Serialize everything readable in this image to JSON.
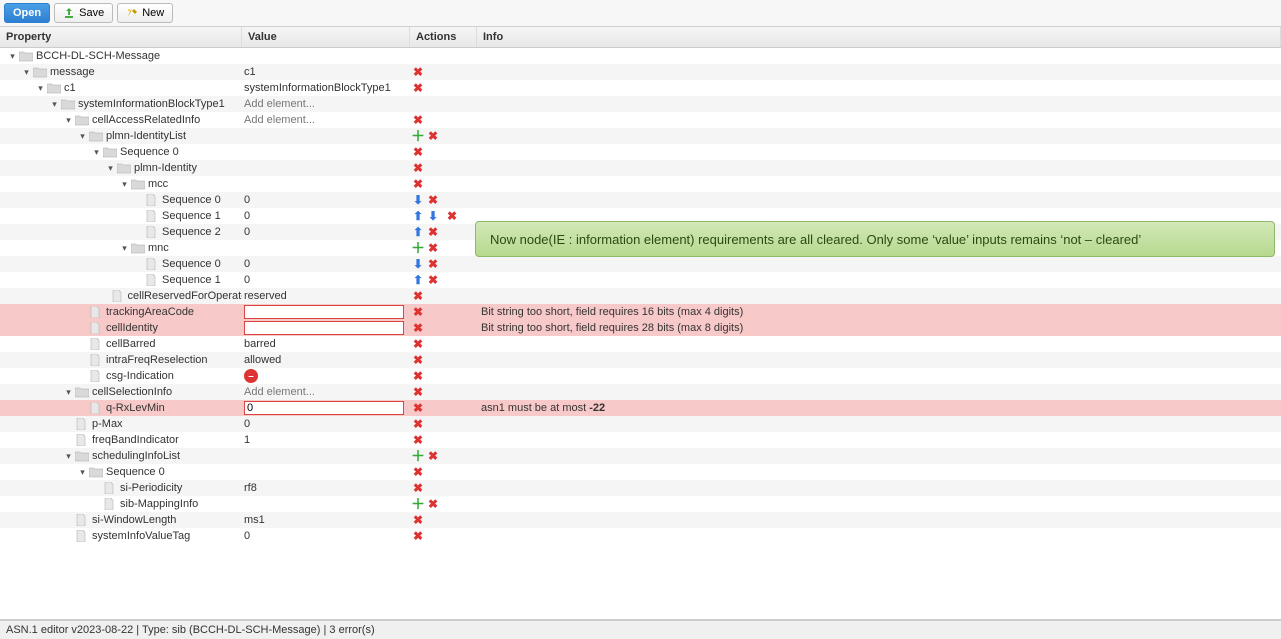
{
  "toolbar": {
    "open": "Open",
    "save": "Save",
    "new_": "New"
  },
  "columns": {
    "property": "Property",
    "value": "Value",
    "actions": "Actions",
    "info": "Info"
  },
  "rows": [
    {
      "depth": 0,
      "exp": true,
      "kind": "folder",
      "label": "BCCH-DL-SCH-Message",
      "value": "",
      "actions": [],
      "info": ""
    },
    {
      "depth": 1,
      "exp": true,
      "kind": "folder",
      "label": "message",
      "value": "c1",
      "actions": [
        "del"
      ],
      "info": ""
    },
    {
      "depth": 2,
      "exp": true,
      "kind": "folder",
      "label": "c1",
      "value": "systemInformationBlockType1",
      "actions": [
        "del"
      ],
      "info": ""
    },
    {
      "depth": 3,
      "exp": true,
      "kind": "folder",
      "label": "systemInformationBlockType1",
      "value": "Add element...",
      "valueClass": "addel",
      "actions": [],
      "info": ""
    },
    {
      "depth": 4,
      "exp": true,
      "kind": "folder",
      "label": "cellAccessRelatedInfo",
      "value": "Add element...",
      "valueClass": "addel",
      "actions": [
        "del"
      ],
      "info": ""
    },
    {
      "depth": 5,
      "exp": true,
      "kind": "folder",
      "label": "plmn-IdentityList",
      "value": "",
      "actions": [
        "add",
        "del"
      ],
      "info": ""
    },
    {
      "depth": 6,
      "exp": true,
      "kind": "folder",
      "label": "Sequence 0",
      "value": "",
      "actions": [
        "del"
      ],
      "info": ""
    },
    {
      "depth": 7,
      "exp": true,
      "kind": "folder",
      "label": "plmn-Identity",
      "value": "",
      "actions": [
        "del"
      ],
      "info": ""
    },
    {
      "depth": 8,
      "exp": true,
      "kind": "folder",
      "label": "mcc",
      "value": "",
      "actions": [
        "del"
      ],
      "info": ""
    },
    {
      "depth": 9,
      "exp": null,
      "kind": "leaf",
      "label": "Sequence 0",
      "value": "0",
      "actions": [
        "down",
        "del"
      ],
      "info": ""
    },
    {
      "depth": 9,
      "exp": null,
      "kind": "leaf",
      "label": "Sequence 1",
      "value": "0",
      "actions": [
        "up",
        "down",
        "del3"
      ],
      "info": ""
    },
    {
      "depth": 9,
      "exp": null,
      "kind": "leaf",
      "label": "Sequence 2",
      "value": "0",
      "actions": [
        "up",
        "del"
      ],
      "info": ""
    },
    {
      "depth": 8,
      "exp": true,
      "kind": "folder",
      "label": "mnc",
      "value": "",
      "actions": [
        "add",
        "del"
      ],
      "info": ""
    },
    {
      "depth": 9,
      "exp": null,
      "kind": "leaf",
      "label": "Sequence 0",
      "value": "0",
      "actions": [
        "down",
        "del"
      ],
      "info": ""
    },
    {
      "depth": 9,
      "exp": null,
      "kind": "leaf",
      "label": "Sequence 1",
      "value": "0",
      "actions": [
        "up",
        "del"
      ],
      "info": ""
    },
    {
      "depth": 7,
      "exp": null,
      "kind": "leaf",
      "label": "cellReservedForOperatorUse",
      "value": "reserved",
      "actions": [
        "del"
      ],
      "info": ""
    },
    {
      "depth": 5,
      "exp": null,
      "kind": "leaf",
      "label": "trackingAreaCode",
      "value": "",
      "valueInput": true,
      "actions": [
        "del"
      ],
      "info": "Bit string too short, field requires 16 bits (max 4 digits)",
      "err": true
    },
    {
      "depth": 5,
      "exp": null,
      "kind": "leaf",
      "label": "cellIdentity",
      "value": "",
      "valueInput": true,
      "actions": [
        "del"
      ],
      "info": "Bit string too short, field requires 28 bits (max 8 digits)",
      "err": true
    },
    {
      "depth": 5,
      "exp": null,
      "kind": "leaf",
      "label": "cellBarred",
      "value": "barred",
      "actions": [
        "del"
      ],
      "info": ""
    },
    {
      "depth": 5,
      "exp": null,
      "kind": "leaf",
      "label": "intraFreqReselection",
      "value": "allowed",
      "actions": [
        "del"
      ],
      "info": ""
    },
    {
      "depth": 5,
      "exp": null,
      "kind": "leaf",
      "label": "csg-Indication",
      "value": "",
      "valueNo": true,
      "actions": [
        "del"
      ],
      "info": ""
    },
    {
      "depth": 4,
      "exp": true,
      "kind": "folder",
      "label": "cellSelectionInfo",
      "value": "Add element...",
      "valueClass": "addel",
      "actions": [
        "del"
      ],
      "info": ""
    },
    {
      "depth": 5,
      "exp": null,
      "kind": "leaf",
      "label": "q-RxLevMin",
      "value": "0",
      "valueInput": true,
      "actions": [
        "del"
      ],
      "info": "asn1 must be at most -22",
      "infoBoldTail": "-22",
      "err": true
    },
    {
      "depth": 4,
      "exp": null,
      "kind": "leaf",
      "label": "p-Max",
      "value": "0",
      "actions": [
        "del"
      ],
      "info": ""
    },
    {
      "depth": 4,
      "exp": null,
      "kind": "leaf",
      "label": "freqBandIndicator",
      "value": "1",
      "actions": [
        "del"
      ],
      "info": ""
    },
    {
      "depth": 4,
      "exp": true,
      "kind": "folder",
      "label": "schedulingInfoList",
      "value": "",
      "actions": [
        "add",
        "del"
      ],
      "info": ""
    },
    {
      "depth": 5,
      "exp": true,
      "kind": "folder",
      "label": "Sequence 0",
      "value": "",
      "actions": [
        "del"
      ],
      "info": ""
    },
    {
      "depth": 6,
      "exp": null,
      "kind": "leaf",
      "label": "si-Periodicity",
      "value": "rf8",
      "actions": [
        "del"
      ],
      "info": ""
    },
    {
      "depth": 6,
      "exp": null,
      "kind": "leaf",
      "label": "sib-MappingInfo",
      "value": "",
      "actions": [
        "add",
        "del"
      ],
      "info": ""
    },
    {
      "depth": 4,
      "exp": null,
      "kind": "leaf",
      "label": "si-WindowLength",
      "value": "ms1",
      "actions": [
        "del"
      ],
      "info": ""
    },
    {
      "depth": 4,
      "exp": null,
      "kind": "leaf",
      "label": "systemInfoValueTag",
      "value": "0",
      "actions": [
        "del"
      ],
      "info": ""
    }
  ],
  "callout": "Now node(IE : information element) requirements are all cleared. Only some ‘value’ inputs remains ‘not – cleared’",
  "status": "ASN.1 editor v2023-08-22 | Type: sib (BCCH-DL-SCH-Message) | 3 error(s)"
}
